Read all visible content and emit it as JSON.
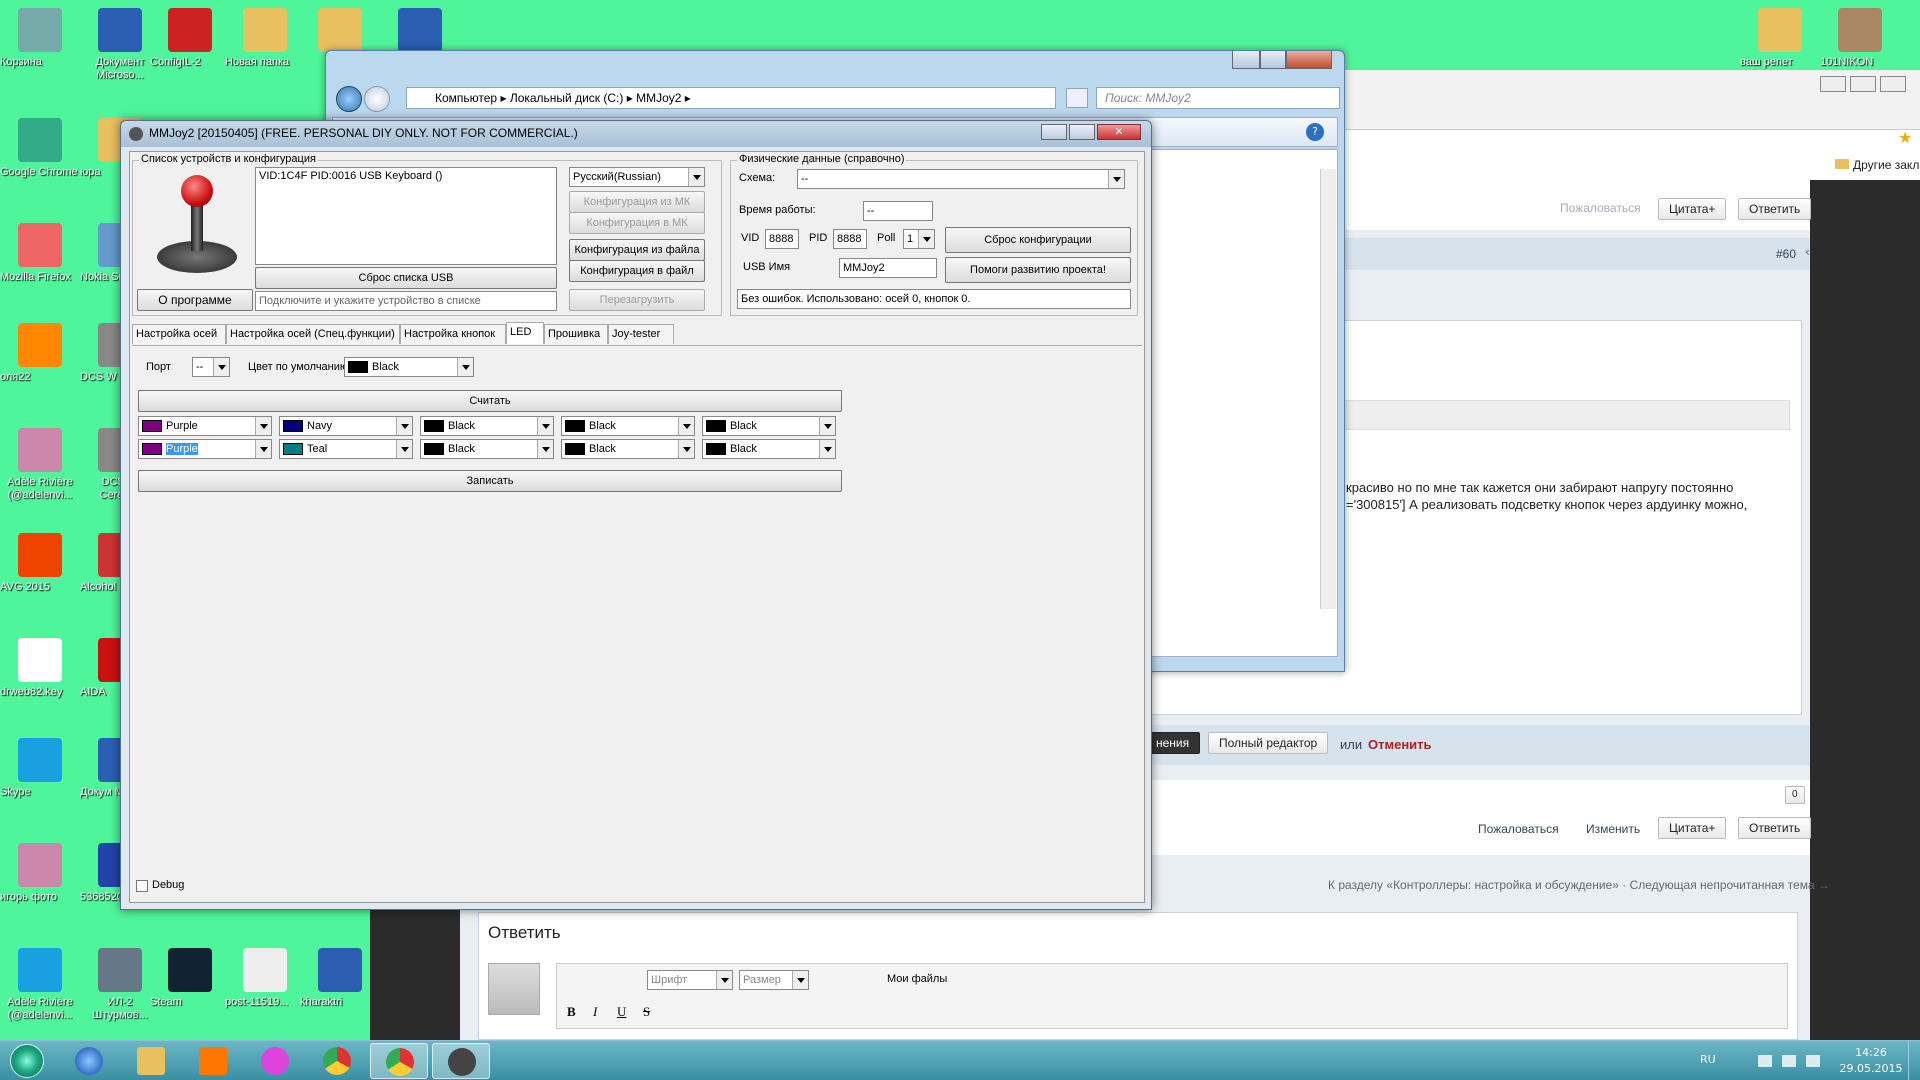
{
  "desktop_icons": [
    {
      "label": "Корзина",
      "color": "#7aa"
    },
    {
      "label": "Документ Microso...",
      "color": "#2b5fb3"
    },
    {
      "label": "ConfigIL-2",
      "color": "#c22"
    },
    {
      "label": "Новая папка",
      "color": "#e8c060"
    },
    {
      "label": "",
      "color": "#e8c060"
    },
    {
      "label": "",
      "color": "#2b5fb3"
    },
    {
      "label": "Google Chrome",
      "color": "#3a8"
    },
    {
      "label": "юра",
      "color": "#e8c060"
    },
    {
      "label": "Mozilla Firefox",
      "color": "#e66"
    },
    {
      "label": "Nokia Suit",
      "color": "#69c"
    },
    {
      "label": "оля22",
      "color": "#f80"
    },
    {
      "label": "DCS W",
      "color": "#888"
    },
    {
      "label": "Adèle Rivière (@adelenvi...",
      "color": "#c8a"
    },
    {
      "label": "DCS W Сеrevas",
      "color": "#888"
    },
    {
      "label": "AVG 2015",
      "color": "#e40"
    },
    {
      "label": "Alcohol",
      "color": "#c33"
    },
    {
      "label": "drweb82.key",
      "color": "#fff"
    },
    {
      "label": "AIDA",
      "color": "#c11"
    },
    {
      "label": "Skype",
      "color": "#1aa0e0"
    },
    {
      "label": "Докум Micro",
      "color": "#2b5fb3"
    },
    {
      "label": "игорь фото",
      "color": "#c8a"
    },
    {
      "label": "5368520...",
      "color": "#24a"
    },
    {
      "label": "Adèle Rivière (@adelenvi...",
      "color": "#1aa0e0"
    },
    {
      "label": "ИЛ-2 Штурмов...",
      "color": "#678"
    },
    {
      "label": "Steam",
      "color": "#123"
    },
    {
      "label": "post-11519...",
      "color": "#eee"
    },
    {
      "label": "kharaktri",
      "color": "#2b5fb3"
    },
    {
      "label": "ваш репет",
      "color": "#e8c060"
    },
    {
      "label": "101NIKON",
      "color": "#a86"
    }
  ],
  "explorer": {
    "breadcrumb": [
      "Компьютер",
      "Локальный диск (C:)",
      "MMJoy2"
    ],
    "search_placeholder": "Поиск: MMJoy2"
  },
  "mmjoy": {
    "title": "MMJoy2 [20150405] (FREE. PERSONAL DIY ONLY. NOT FOR COMMERCIAL.)",
    "devices_group": "Список устройств и конфигурация",
    "device_list": [
      "VID:1C4F PID:0016 USB Keyboard ()"
    ],
    "reset_usb": "Сброс списка USB",
    "about": "О программе",
    "status_hint": "Подключите и укажите устройство в списке",
    "language": "Русский(Russian)",
    "cfg_from_mk": "Конфигурация из МК",
    "cfg_to_mk": "Конфигурация в МК",
    "cfg_from_file": "Конфигурация из файла",
    "cfg_to_file": "Конфигурация в файл",
    "reboot": "Перезагрузить",
    "phys_group": "Физические данные (справочно)",
    "scheme_label": "Схема:",
    "scheme_value": "--",
    "uptime_label": "Время работы:",
    "uptime_value": "--",
    "vid_label": "VID",
    "vid_value": "8888",
    "pid_label": "PID",
    "pid_value": "8888",
    "poll_label": "Poll",
    "poll_value": "1",
    "usbname_label": "USB Имя",
    "usbname_value": "MMJoy2",
    "reset_cfg": "Сброс конфигурации",
    "help_project": "Помоги развитию проекта!",
    "status_line": "Без ошибок. Использовано: осей  0, кнопок  0.",
    "tabs": [
      "Настройка осей",
      "Настройка осей (Спец.функции)",
      "Настройка кнопок",
      "LED",
      "Прошивка",
      "Joy-tester"
    ],
    "selected_tab": "LED",
    "port_label": "Порт",
    "port_value": "--",
    "default_color_label": "Цвет по умолчанию",
    "default_color_value": "Black",
    "read_button": "Считать",
    "write_button": "Записать",
    "row1": [
      {
        "name": "Purple",
        "color": "#800080"
      },
      {
        "name": "Navy",
        "color": "#000080"
      },
      {
        "name": "Black",
        "color": "#000000"
      },
      {
        "name": "Black",
        "color": "#000000"
      },
      {
        "name": "Black",
        "color": "#000000"
      }
    ],
    "row2": [
      {
        "name": "Purple",
        "color": "#800080"
      },
      {
        "name": "Teal",
        "color": "#008080"
      },
      {
        "name": "Black",
        "color": "#000000"
      },
      {
        "name": "Black",
        "color": "#000000"
      },
      {
        "name": "Black",
        "color": "#000000"
      }
    ],
    "debug_label": "Debug"
  },
  "forum": {
    "bookmarks": "Другие закл",
    "report": "Пожаловаться",
    "quote": "Цитата+",
    "reply": "Ответить",
    "post_num": "#60",
    "post_text_1": "красиво но по мне так кажется они забирают напругу постоянно",
    "post_text_2": "='300815'] А реализовать подсветку кнопок через ардуинку можно,",
    "save_changes": "нения",
    "full_editor": "Полный редактор",
    "or": "или",
    "cancel": "Отменить",
    "count": "0",
    "report2": "Пожаловаться",
    "edit": "Изменить",
    "quote2": "Цитата+",
    "reply2": "Ответить",
    "nav": "К разделу «Контроллеры: настройка и обсуждение» · Следующая непрочитанная тема →",
    "reply_title": "Ответить",
    "font": "Шрифт",
    "size": "Размер",
    "my_files": "Мои файлы"
  },
  "taskbar": {
    "lang": "RU",
    "time": "14:26",
    "date": "29.05.2015"
  }
}
